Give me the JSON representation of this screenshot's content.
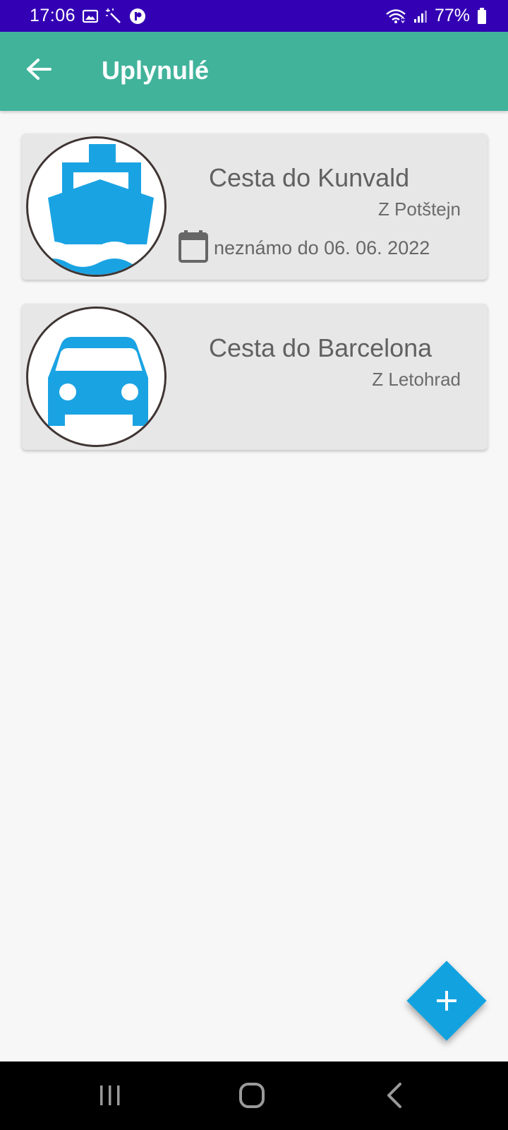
{
  "status_bar": {
    "time": "17:06",
    "battery": "77%",
    "icons": [
      "gallery-icon",
      "magic-wand-icon",
      "app-notification-icon",
      "wifi-icon",
      "signal-icon",
      "battery-icon"
    ]
  },
  "app_bar": {
    "title": "Uplynulé",
    "back_icon": "arrow-left-icon"
  },
  "trips": [
    {
      "title": "Cesta do Kunvald",
      "origin": "Z Potštejn",
      "date": "neznámo do 06. 06. 2022",
      "icon": "ship-icon",
      "date_icon": "calendar-icon"
    },
    {
      "title": "Cesta do Barcelona",
      "origin": "Z Letohrad",
      "icon": "car-icon"
    }
  ],
  "fab": {
    "icon": "plus-icon"
  },
  "nav_bar": {
    "icons": [
      "recent-apps-icon",
      "home-icon",
      "back-icon"
    ]
  },
  "colors": {
    "status_bar": "#3300b4",
    "app_bar": "#41b39b",
    "accent": "#12a2df",
    "card": "#e7e7e7",
    "background": "#f7f7f7"
  }
}
